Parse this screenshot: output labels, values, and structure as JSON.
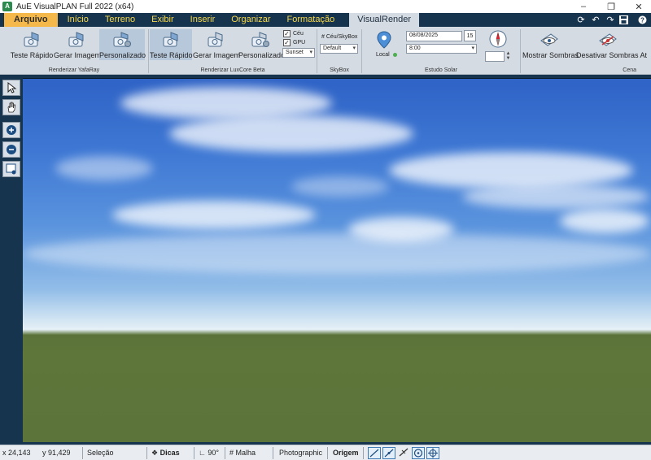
{
  "window": {
    "title": "AuE VisualPLAN Full 2022 (x64)",
    "app_icon": "app-logo-icon",
    "controls": [
      "minimize-icon",
      "restore-icon",
      "close-icon"
    ]
  },
  "menu": {
    "tabs": [
      "Arquivo",
      "Início",
      "Terreno",
      "Exibir",
      "Inserir",
      "Organizar",
      "Formatação",
      "VisualRender"
    ],
    "active_tab": "VisualRender",
    "colors": {
      "bar": "#17344f",
      "tab_text": "#f7d94a",
      "file_tab": "#f5b84a",
      "active_tab": "#d4dbe3"
    },
    "quick_access": [
      "refresh-icon",
      "undo-icon",
      "redo-icon",
      "save-icon",
      "help-icon"
    ]
  },
  "ribbon": {
    "yafaray": {
      "label": "Renderizar YafaRay",
      "buttons": [
        "Teste Rápido",
        "Gerar Imagem",
        "Personalizado"
      ]
    },
    "luxcore": {
      "label": "Renderizar LuxCore Beta",
      "buttons": [
        "Teste Rápido",
        "Gerar Imagem",
        "Personalizado"
      ],
      "checks": [
        {
          "label": "Céu",
          "checked": true
        },
        {
          "label": "GPU",
          "checked": true
        }
      ],
      "preset": "Sunset"
    },
    "skybox": {
      "label": "SkyBox",
      "option": "Céu/SkyBox",
      "value": "Default"
    },
    "solar": {
      "label": "Estudo Solar",
      "location_label": "Local",
      "date": "08/08/2025",
      "calendar_day": "15",
      "time": "8:00"
    },
    "scene": {
      "label": "Cena",
      "buttons": [
        "Mostrar Sombras",
        "Desativar Sombras At"
      ]
    }
  },
  "statusbar": {
    "x": "x 24,143",
    "y": "y 91,429",
    "mode": "Seleção",
    "hints": "Dicas",
    "angle": "90°",
    "grid": "Malha",
    "style": "Photographic",
    "origin": "Origem"
  }
}
